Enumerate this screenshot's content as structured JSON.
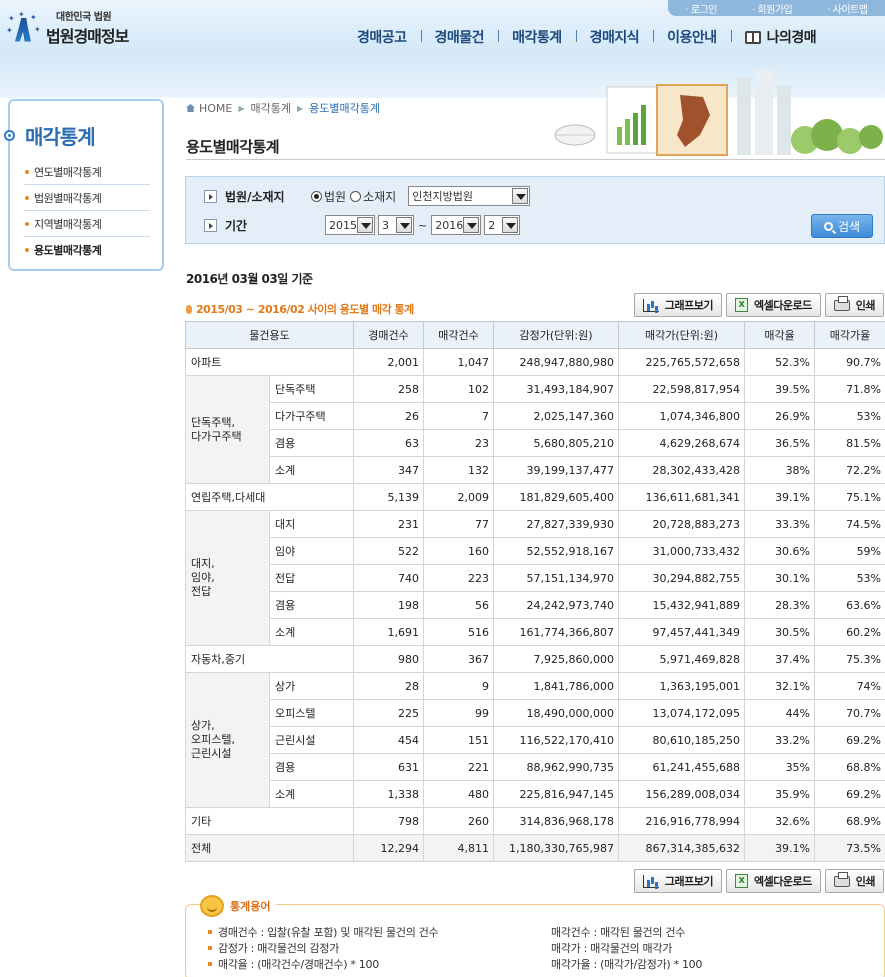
{
  "header": {
    "logo_sub": "대한민국 법원",
    "logo_main": "법원경매정보",
    "top_links": [
      "로그인",
      "회원가입",
      "사이트맵"
    ],
    "gnb": [
      "경매공고",
      "경매물건",
      "매각통계",
      "경매지식",
      "이용안내",
      "나의경매"
    ]
  },
  "sidebar": {
    "title": "매각통계",
    "items": [
      "연도별매각통계",
      "법원별매각통계",
      "지역별매각통계",
      "용도별매각통계"
    ]
  },
  "breadcrumb": {
    "home": "HOME",
    "section": "매각통계",
    "current": "용도별매각통계"
  },
  "page_title": "용도별매각통계",
  "search": {
    "court_label": "법원/소재지",
    "radio_court": "법원",
    "radio_location": "소재지",
    "court_value": "인천지방법원",
    "period_label": "기간",
    "from_year": "2015",
    "from_month": "3",
    "to_year": "2016",
    "to_month": "2",
    "tilde": "~",
    "search_button": "검색"
  },
  "basis_date": "2016년 03월 03일 기준",
  "stats_title": "2015/03 ~ 2016/02 사이의 용도별 매각 통계",
  "buttons": {
    "graph": "그래프보기",
    "excel": "엑셀다운로드",
    "print": "인쇄"
  },
  "table": {
    "headers": [
      "물건용도",
      "경매건수",
      "매각건수",
      "감정가(단위:원)",
      "매각가(단위:원)",
      "매각율",
      "매각가율"
    ],
    "rows": [
      {
        "label": "아파트",
        "v": [
          "2,001",
          "1,047",
          "248,947,880,980",
          "225,765,572,658",
          "52.3%",
          "90.7%"
        ]
      },
      {
        "group": "단독주택,\n다가구주택",
        "label": "단독주택",
        "v": [
          "258",
          "102",
          "31,493,184,907",
          "22,598,817,954",
          "39.5%",
          "71.8%"
        ]
      },
      {
        "label": "다가구주택",
        "v": [
          "26",
          "7",
          "2,025,147,360",
          "1,074,346,800",
          "26.9%",
          "53%"
        ]
      },
      {
        "label": "겸용",
        "v": [
          "63",
          "23",
          "5,680,805,210",
          "4,629,268,674",
          "36.5%",
          "81.5%"
        ]
      },
      {
        "label": "소계",
        "v": [
          "347",
          "132",
          "39,199,137,477",
          "28,302,433,428",
          "38%",
          "72.2%"
        ]
      },
      {
        "label": "연립주택,다세대",
        "v": [
          "5,139",
          "2,009",
          "181,829,605,400",
          "136,611,681,341",
          "39.1%",
          "75.1%"
        ]
      },
      {
        "group": "대지,\n임야,\n전답",
        "label": "대지",
        "v": [
          "231",
          "77",
          "27,827,339,930",
          "20,728,883,273",
          "33.3%",
          "74.5%"
        ]
      },
      {
        "label": "임야",
        "v": [
          "522",
          "160",
          "52,552,918,167",
          "31,000,733,432",
          "30.6%",
          "59%"
        ]
      },
      {
        "label": "전답",
        "v": [
          "740",
          "223",
          "57,151,134,970",
          "30,294,882,755",
          "30.1%",
          "53%"
        ]
      },
      {
        "label": "겸용",
        "v": [
          "198",
          "56",
          "24,242,973,740",
          "15,432,941,889",
          "28.3%",
          "63.6%"
        ]
      },
      {
        "label": "소계",
        "v": [
          "1,691",
          "516",
          "161,774,366,807",
          "97,457,441,349",
          "30.5%",
          "60.2%"
        ]
      },
      {
        "label": "자동차,중기",
        "v": [
          "980",
          "367",
          "7,925,860,000",
          "5,971,469,828",
          "37.4%",
          "75.3%"
        ]
      },
      {
        "group": "상가,\n오피스텔,\n근린시설",
        "label": "상가",
        "v": [
          "28",
          "9",
          "1,841,786,000",
          "1,363,195,001",
          "32.1%",
          "74%"
        ]
      },
      {
        "label": "오피스텔",
        "v": [
          "225",
          "99",
          "18,490,000,000",
          "13,074,172,095",
          "44%",
          "70.7%"
        ]
      },
      {
        "label": "근린시설",
        "v": [
          "454",
          "151",
          "116,522,170,410",
          "80,610,185,250",
          "33.2%",
          "69.2%"
        ]
      },
      {
        "label": "겸용",
        "v": [
          "631",
          "221",
          "88,962,990,735",
          "61,241,455,688",
          "35%",
          "68.8%"
        ]
      },
      {
        "label": "소계",
        "v": [
          "1,338",
          "480",
          "225,816,947,145",
          "156,289,008,034",
          "35.9%",
          "69.2%"
        ]
      },
      {
        "label": "기타",
        "v": [
          "798",
          "260",
          "314,836,968,178",
          "216,916,778,994",
          "32.6%",
          "68.9%"
        ]
      },
      {
        "label": "전체",
        "v": [
          "12,294",
          "4,811",
          "1,180,330,765,987",
          "867,314,385,632",
          "39.1%",
          "73.5%"
        ]
      }
    ]
  },
  "terms": {
    "title": "통계용어",
    "items": [
      "경매건수 : 입찰(유찰 포함) 및 매각된 물건의 건수",
      "매각건수 : 매각된 물건의 건수",
      "감정가 : 매각물건의 감정가",
      "매각가 : 매각물건의 매각가",
      "매각율 : (매각건수/경매건수) * 100",
      "매각가율 : (매각가/감정가) * 100"
    ]
  }
}
